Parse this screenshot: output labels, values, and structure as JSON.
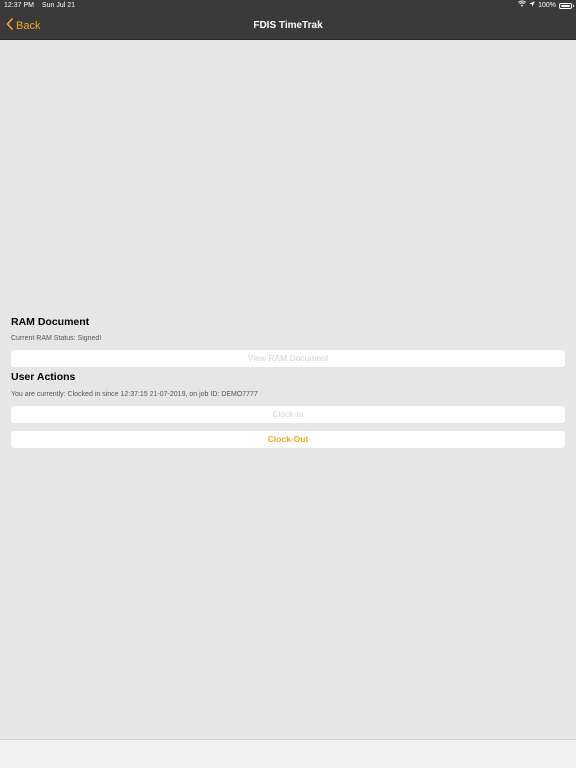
{
  "status_bar": {
    "time": "12:37 PM",
    "date": "Sun Jul 21",
    "battery": "100%",
    "battery_level": 1.0
  },
  "nav": {
    "back_label": "Back",
    "title": "FDIS TimeTrak"
  },
  "ram_section": {
    "title": "RAM Document",
    "status_text": "Current RAM Status: Signed!",
    "view_button_label": "View RAM Document"
  },
  "user_actions": {
    "title": "User Actions",
    "status_text": "You are currently: Clocked in since 12:37:15 21-07-2019, on job ID: DEMO7777",
    "clock_in_label": "Clock-In",
    "clock_out_label": "Clock-Out"
  },
  "colors": {
    "accent": "#f5a623",
    "nav_background": "#3a3a3a",
    "page_background": "#e6e6e6",
    "disabled_text": "#d4d4d4"
  },
  "icons": [
    "wifi-icon",
    "location-arrow-icon",
    "battery-icon",
    "chevron-left-icon"
  ]
}
